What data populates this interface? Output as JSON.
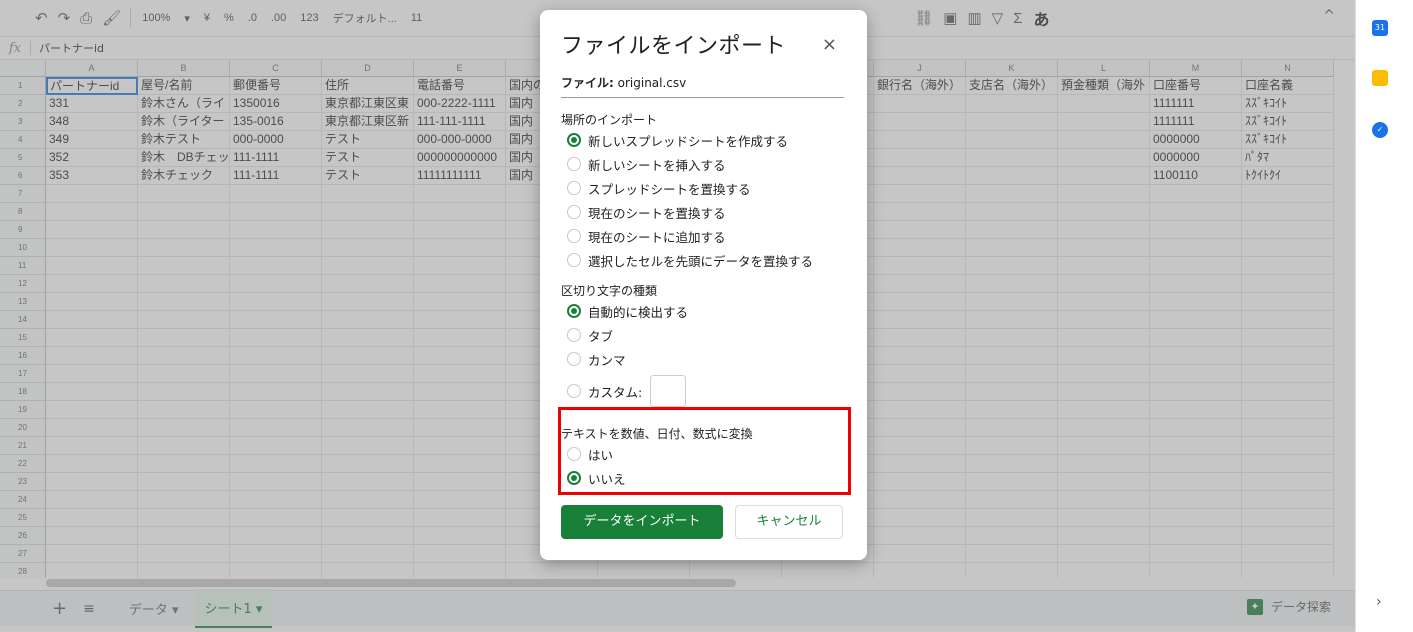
{
  "toolbar": {
    "undo": "↶",
    "redo": "↷",
    "print": "⎙",
    "paint": "🖌",
    "zoom": "100%",
    "currency": "¥",
    "percent": "%",
    "dec_dec": ".0",
    "dec_inc": ".00",
    "format": "123",
    "font": "デフォルト...",
    "font_size": "11",
    "kana": "あ",
    "collapse": "^"
  },
  "formula_bar": {
    "fx": "fx",
    "value": "パートナーid"
  },
  "columns": [
    "A",
    "B",
    "C",
    "D",
    "E",
    "F",
    "G",
    "H",
    "I",
    "J",
    "K",
    "L",
    "M",
    "N"
  ],
  "header_row": [
    "パートナーid",
    "屋号/名前",
    "郵便番号",
    "住所",
    "電話番号",
    "国内の",
    "",
    "",
    "",
    "銀行名（海外）",
    "支店名（海外）",
    "預金種類（海外",
    "口座番号",
    "口座名義"
  ],
  "rows": [
    [
      "331",
      "鈴木さん（ライ",
      "1350016",
      "東京都江東区東",
      "000-2222-1111",
      "国内",
      "",
      "",
      "",
      "",
      "",
      "",
      "1111111",
      "ｽｽﾞｷｺｲﾄ"
    ],
    [
      "348",
      "鈴木（ライター",
      "135-0016",
      "東京都江東区新",
      "111-111-1111",
      "国内",
      "",
      "",
      "",
      "",
      "",
      "",
      "1111111",
      "ｽｽﾞｷｺｲﾄ"
    ],
    [
      "349",
      "鈴木テスト",
      "000-0000",
      "テスト",
      "000-000-0000",
      "国内",
      "",
      "",
      "",
      "",
      "",
      "",
      "0000000",
      "ｽｽﾞｷｺｲﾄ"
    ],
    [
      "352",
      "鈴木　DBチェッ",
      "111-1111",
      "テスト",
      "000000000000",
      "国内",
      "",
      "",
      "",
      "",
      "",
      "",
      "0000000",
      "ﾊﾟﾀﾏ"
    ],
    [
      "353",
      "鈴木チェック",
      "111-1111",
      "テスト",
      "11111111111",
      "国内",
      "",
      "",
      "",
      "",
      "",
      "",
      "1100110",
      "ﾄｸｲﾄｸｲ"
    ]
  ],
  "row_numbers": [
    "1",
    "2",
    "3",
    "4",
    "5",
    "6",
    "7",
    "8",
    "9",
    "10",
    "11",
    "12",
    "13",
    "14",
    "15",
    "16",
    "17",
    "18",
    "19",
    "20",
    "21",
    "22",
    "23",
    "24",
    "25",
    "26",
    "27",
    "28"
  ],
  "sheet_tabs": {
    "add": "+",
    "list": "≡",
    "tab1": "データ ▾",
    "tab2": "シート1 ▾"
  },
  "explore": "データ探索",
  "side_panel": {
    "calendar": "31",
    "keep": "",
    "tasks": "✓",
    "expand": "›"
  },
  "dialog": {
    "title": "ファイルをインポート",
    "close": "×",
    "file_label": "ファイル:",
    "file_name": "original.csv",
    "location_label": "場所のインポート",
    "location_options": [
      {
        "label": "新しいスプレッドシートを作成する",
        "selected": true
      },
      {
        "label": "新しいシートを挿入する",
        "selected": false
      },
      {
        "label": "スプレッドシートを置換する",
        "selected": false
      },
      {
        "label": "現在のシートを置換する",
        "selected": false
      },
      {
        "label": "現在のシートに追加する",
        "selected": false
      },
      {
        "label": "選択したセルを先頭にデータを置換する",
        "selected": false
      }
    ],
    "separator_label": "区切り文字の種類",
    "separator_options": [
      {
        "label": "自動的に検出する",
        "selected": true
      },
      {
        "label": "タブ",
        "selected": false
      },
      {
        "label": "カンマ",
        "selected": false
      }
    ],
    "custom_label": "カスタム:",
    "convert_label": "テキストを数値、日付、数式に変換",
    "convert_options": [
      {
        "label": "はい",
        "selected": false
      },
      {
        "label": "いいえ",
        "selected": true
      }
    ],
    "import_button": "データをインポート",
    "cancel_button": "キャンセル"
  },
  "colors": {
    "accent": "#188038",
    "highlight": "#ee0000",
    "selection": "#1a73e8"
  }
}
